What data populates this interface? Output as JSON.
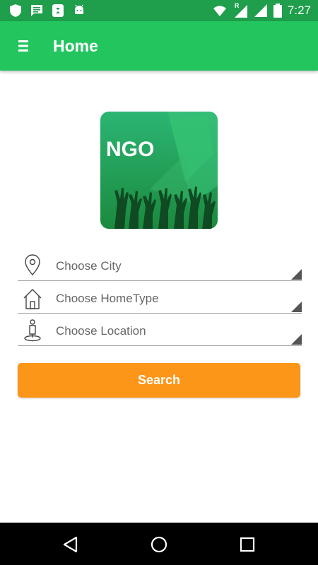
{
  "status_bar": {
    "time": "7:27",
    "signal_badge": "R",
    "left_icons": [
      "shield-icon",
      "message-icon",
      "sync-icon",
      "android-icon"
    ],
    "right_icons": [
      "wifi-icon",
      "signal-icon",
      "signal-icon",
      "battery-icon"
    ]
  },
  "app_bar": {
    "title": "Home",
    "menu_icon": "hamburger-menu-icon",
    "background": "#22c55e"
  },
  "logo": {
    "text": "NGO"
  },
  "form": {
    "city": {
      "placeholder": "Choose City",
      "icon": "location-pin-icon"
    },
    "home_type": {
      "placeholder": "Choose HomeType",
      "icon": "house-icon"
    },
    "location": {
      "placeholder": "Choose Location",
      "icon": "person-pin-icon"
    }
  },
  "search_button": {
    "label": "Search",
    "color": "#fb9618"
  },
  "nav_bar": {
    "back_icon": "back-triangle-icon",
    "home_icon": "home-circle-icon",
    "recents_icon": "recents-square-icon"
  }
}
